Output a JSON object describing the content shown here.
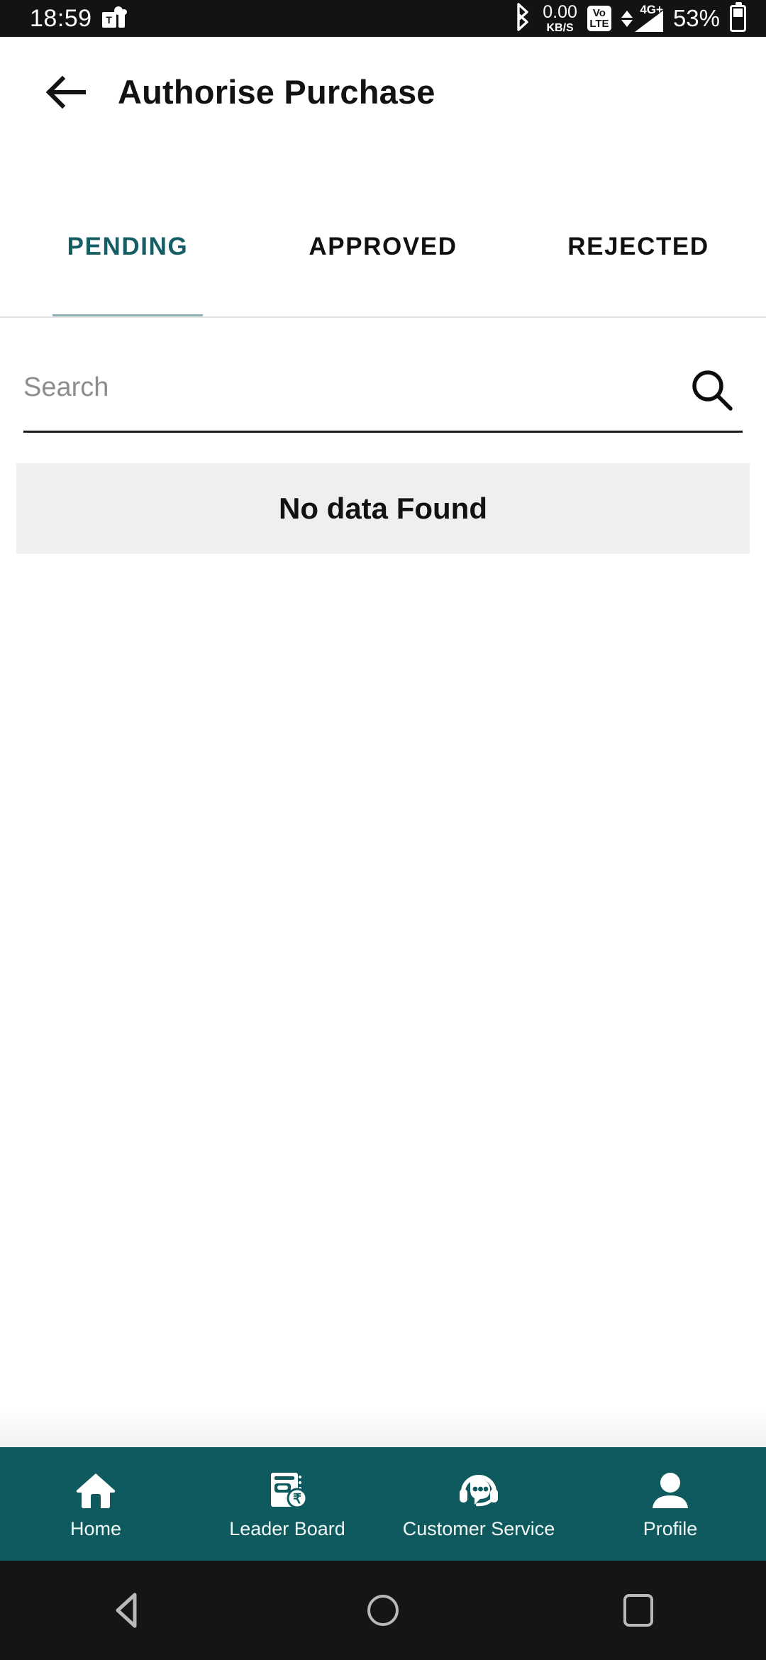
{
  "status_bar": {
    "clock": "18:59",
    "app_badge_icon": "microsoft-teams-icon",
    "app_badge_letter": "T",
    "bluetooth_icon": "bluetooth-icon",
    "data_speed_value": "0.00",
    "data_speed_unit": "KB/S",
    "volte_top": "Vo",
    "volte_bottom": "LTE",
    "network_type": "4G+",
    "signal_icon": "signal-bars-icon",
    "battery_percent": "53%",
    "battery_icon": "battery-icon",
    "background_color": "#131313"
  },
  "header": {
    "back_icon": "arrow-left-icon",
    "title": "Authorise Purchase"
  },
  "tabs": {
    "active_index": 0,
    "items": [
      {
        "label": "PENDING",
        "active": true
      },
      {
        "label": "APPROVED",
        "active": false
      },
      {
        "label": "REJECTED",
        "active": false
      }
    ],
    "active_color": "#155e63",
    "inactive_color": "#101010"
  },
  "search": {
    "placeholder": "Search",
    "value": "",
    "icon": "search-icon"
  },
  "main": {
    "empty_state_text": "No data Found",
    "empty_state_bg": "#efefef"
  },
  "bottom_nav": {
    "background_color": "#0f5a5e",
    "items": [
      {
        "label": "Home",
        "icon": "home-icon"
      },
      {
        "label": "Leader Board",
        "icon": "leaderboard-rupee-icon"
      },
      {
        "label": "Customer Service",
        "icon": "headset-chat-icon"
      },
      {
        "label": "Profile",
        "icon": "person-icon"
      }
    ]
  },
  "android_nav": {
    "back_icon": "triangle-back-icon",
    "home_icon": "circle-home-icon",
    "recents_icon": "square-recents-icon"
  }
}
